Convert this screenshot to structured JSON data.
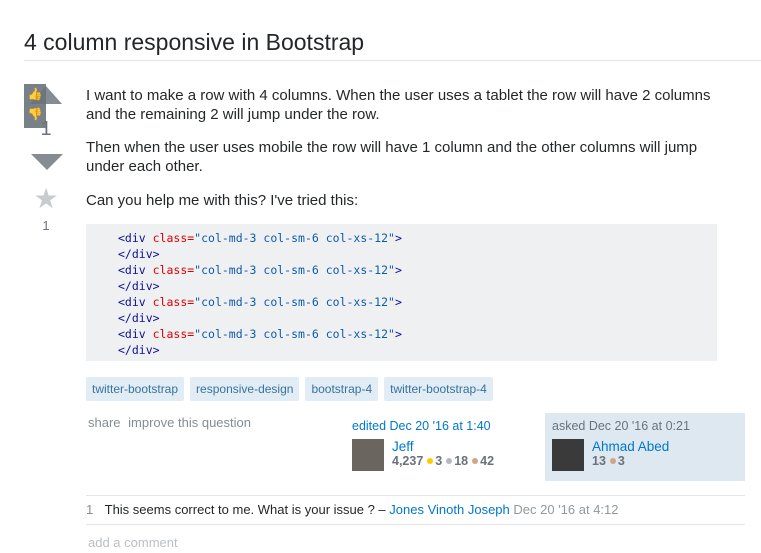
{
  "question": {
    "title": "4 column responsive in Bootstrap",
    "score": "1",
    "favorite_count": "1",
    "paragraphs": [
      "I want to make a row with 4 columns. When the user uses a tablet the row will have 2 columns and the remaining 2 will jump under the row.",
      "Then when the user uses mobile the row will have 1 column and the other columns will jump under each other.",
      "Can you help me with this? I've tried this:"
    ],
    "code": {
      "open_tag": "<div",
      "attr": " class=",
      "value": "\"col-md-3 col-sm-6 col-xs-12\"",
      "open_end": ">",
      "close_tag": "</div>"
    },
    "tags": [
      "twitter-bootstrap",
      "responsive-design",
      "bootstrap-4",
      "twitter-bootstrap-4"
    ],
    "menu": [
      "share",
      "improve this question"
    ],
    "edited": {
      "label": "edited Dec 20 '16 at 1:40",
      "name": "Jeff",
      "rep": "4,237",
      "gold": "3",
      "silver": "18",
      "bronze": "42"
    },
    "asked": {
      "label": "asked Dec 20 '16 at 0:21",
      "name": "Ahmad Abed",
      "rep": "13",
      "bronze": "3"
    },
    "comment": {
      "score": "1",
      "text": "This seems correct to me. What is your issue ? –",
      "user": "Jones Vinoth Joseph",
      "date": "Dec 20 '16 at 4:12"
    },
    "add_comment": "add a comment"
  },
  "colors": {
    "gold": "#ffcc01",
    "silver": "#b4b8bc",
    "bronze": "#d1a684",
    "link": "#0077cc"
  }
}
